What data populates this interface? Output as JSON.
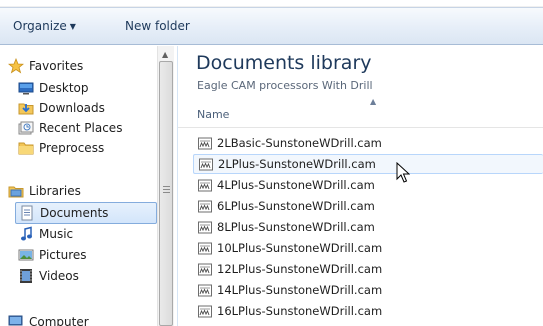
{
  "toolbar": {
    "organize_label": "Organize",
    "new_folder_label": "New folder"
  },
  "nav": {
    "favorites": {
      "label": "Favorites",
      "items": [
        {
          "label": "Desktop",
          "icon": "desktop-icon"
        },
        {
          "label": "Downloads",
          "icon": "downloads-icon"
        },
        {
          "label": "Recent Places",
          "icon": "recent-places-icon"
        },
        {
          "label": "Preprocess",
          "icon": "folder-icon"
        }
      ]
    },
    "libraries": {
      "label": "Libraries",
      "items": [
        {
          "label": "Documents",
          "icon": "documents-icon",
          "selected": true
        },
        {
          "label": "Music",
          "icon": "music-icon"
        },
        {
          "label": "Pictures",
          "icon": "pictures-icon"
        },
        {
          "label": "Videos",
          "icon": "videos-icon"
        }
      ]
    },
    "computer": {
      "label": "Computer"
    }
  },
  "library": {
    "title": "Documents library",
    "subtitle": "Eagle CAM processors With Drill"
  },
  "columns": {
    "name": "Name"
  },
  "files": [
    "2LBasic-SunstoneWDrill.cam",
    "2LPlus-SunstoneWDrill.cam",
    "4LPlus-SunstoneWDrill.cam",
    "6LPlus-SunstoneWDrill.cam",
    "8LPlus-SunstoneWDrill.cam",
    "10LPlus-SunstoneWDrill.cam",
    "12LPlus-SunstoneWDrill.cam",
    "14LPlus-SunstoneWDrill.cam",
    "16LPlus-SunstoneWDrill.cam"
  ],
  "hovered_file": "2LPlus-SunstoneWDrill.cam",
  "colors": {
    "title_blue": "#1e395b",
    "hover_border": "#b8d6fb",
    "selected_border": "#84acdd"
  }
}
